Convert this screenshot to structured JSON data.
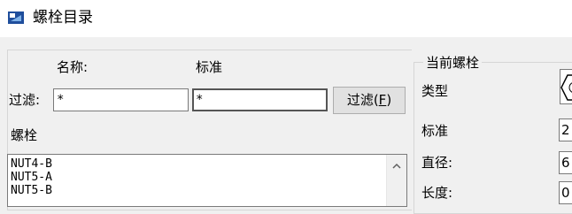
{
  "window": {
    "title": "螺栓目录",
    "icon": "app-icon"
  },
  "filter": {
    "name_header": "名称:",
    "standard_header": "标准",
    "label": "过滤:",
    "name_value": "*",
    "standard_value": "*",
    "button_label": "过滤(",
    "button_accel": "F",
    "button_close": ")"
  },
  "list": {
    "label": "螺栓",
    "items": [
      "NUT4-B",
      "NUT5-A",
      "NUT5-B"
    ],
    "scroll_up_icon": "chevron-up-icon"
  },
  "current": {
    "group_title": "当前螺栓",
    "type_label": "类型",
    "standard_label": "标准",
    "standard_value": "2",
    "diameter_label": "直径:",
    "diameter_value": "6",
    "length_label": "长度:",
    "length_value": "0"
  }
}
